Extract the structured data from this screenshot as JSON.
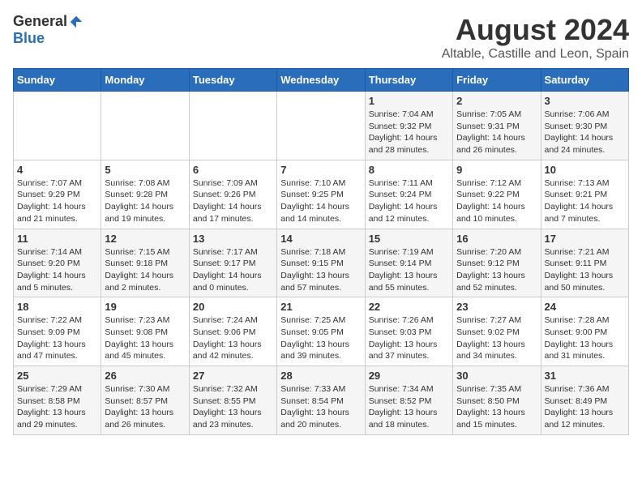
{
  "header": {
    "logo_general": "General",
    "logo_blue": "Blue",
    "main_title": "August 2024",
    "subtitle": "Altable, Castille and Leon, Spain"
  },
  "weekdays": [
    "Sunday",
    "Monday",
    "Tuesday",
    "Wednesday",
    "Thursday",
    "Friday",
    "Saturday"
  ],
  "weeks": [
    [
      {
        "day": "",
        "info": ""
      },
      {
        "day": "",
        "info": ""
      },
      {
        "day": "",
        "info": ""
      },
      {
        "day": "",
        "info": ""
      },
      {
        "day": "1",
        "info": "Sunrise: 7:04 AM\nSunset: 9:32 PM\nDaylight: 14 hours\nand 28 minutes."
      },
      {
        "day": "2",
        "info": "Sunrise: 7:05 AM\nSunset: 9:31 PM\nDaylight: 14 hours\nand 26 minutes."
      },
      {
        "day": "3",
        "info": "Sunrise: 7:06 AM\nSunset: 9:30 PM\nDaylight: 14 hours\nand 24 minutes."
      }
    ],
    [
      {
        "day": "4",
        "info": "Sunrise: 7:07 AM\nSunset: 9:29 PM\nDaylight: 14 hours\nand 21 minutes."
      },
      {
        "day": "5",
        "info": "Sunrise: 7:08 AM\nSunset: 9:28 PM\nDaylight: 14 hours\nand 19 minutes."
      },
      {
        "day": "6",
        "info": "Sunrise: 7:09 AM\nSunset: 9:26 PM\nDaylight: 14 hours\nand 17 minutes."
      },
      {
        "day": "7",
        "info": "Sunrise: 7:10 AM\nSunset: 9:25 PM\nDaylight: 14 hours\nand 14 minutes."
      },
      {
        "day": "8",
        "info": "Sunrise: 7:11 AM\nSunset: 9:24 PM\nDaylight: 14 hours\nand 12 minutes."
      },
      {
        "day": "9",
        "info": "Sunrise: 7:12 AM\nSunset: 9:22 PM\nDaylight: 14 hours\nand 10 minutes."
      },
      {
        "day": "10",
        "info": "Sunrise: 7:13 AM\nSunset: 9:21 PM\nDaylight: 14 hours\nand 7 minutes."
      }
    ],
    [
      {
        "day": "11",
        "info": "Sunrise: 7:14 AM\nSunset: 9:20 PM\nDaylight: 14 hours\nand 5 minutes."
      },
      {
        "day": "12",
        "info": "Sunrise: 7:15 AM\nSunset: 9:18 PM\nDaylight: 14 hours\nand 2 minutes."
      },
      {
        "day": "13",
        "info": "Sunrise: 7:17 AM\nSunset: 9:17 PM\nDaylight: 14 hours\nand 0 minutes."
      },
      {
        "day": "14",
        "info": "Sunrise: 7:18 AM\nSunset: 9:15 PM\nDaylight: 13 hours\nand 57 minutes."
      },
      {
        "day": "15",
        "info": "Sunrise: 7:19 AM\nSunset: 9:14 PM\nDaylight: 13 hours\nand 55 minutes."
      },
      {
        "day": "16",
        "info": "Sunrise: 7:20 AM\nSunset: 9:12 PM\nDaylight: 13 hours\nand 52 minutes."
      },
      {
        "day": "17",
        "info": "Sunrise: 7:21 AM\nSunset: 9:11 PM\nDaylight: 13 hours\nand 50 minutes."
      }
    ],
    [
      {
        "day": "18",
        "info": "Sunrise: 7:22 AM\nSunset: 9:09 PM\nDaylight: 13 hours\nand 47 minutes."
      },
      {
        "day": "19",
        "info": "Sunrise: 7:23 AM\nSunset: 9:08 PM\nDaylight: 13 hours\nand 45 minutes."
      },
      {
        "day": "20",
        "info": "Sunrise: 7:24 AM\nSunset: 9:06 PM\nDaylight: 13 hours\nand 42 minutes."
      },
      {
        "day": "21",
        "info": "Sunrise: 7:25 AM\nSunset: 9:05 PM\nDaylight: 13 hours\nand 39 minutes."
      },
      {
        "day": "22",
        "info": "Sunrise: 7:26 AM\nSunset: 9:03 PM\nDaylight: 13 hours\nand 37 minutes."
      },
      {
        "day": "23",
        "info": "Sunrise: 7:27 AM\nSunset: 9:02 PM\nDaylight: 13 hours\nand 34 minutes."
      },
      {
        "day": "24",
        "info": "Sunrise: 7:28 AM\nSunset: 9:00 PM\nDaylight: 13 hours\nand 31 minutes."
      }
    ],
    [
      {
        "day": "25",
        "info": "Sunrise: 7:29 AM\nSunset: 8:58 PM\nDaylight: 13 hours\nand 29 minutes."
      },
      {
        "day": "26",
        "info": "Sunrise: 7:30 AM\nSunset: 8:57 PM\nDaylight: 13 hours\nand 26 minutes."
      },
      {
        "day": "27",
        "info": "Sunrise: 7:32 AM\nSunset: 8:55 PM\nDaylight: 13 hours\nand 23 minutes."
      },
      {
        "day": "28",
        "info": "Sunrise: 7:33 AM\nSunset: 8:54 PM\nDaylight: 13 hours\nand 20 minutes."
      },
      {
        "day": "29",
        "info": "Sunrise: 7:34 AM\nSunset: 8:52 PM\nDaylight: 13 hours\nand 18 minutes."
      },
      {
        "day": "30",
        "info": "Sunrise: 7:35 AM\nSunset: 8:50 PM\nDaylight: 13 hours\nand 15 minutes."
      },
      {
        "day": "31",
        "info": "Sunrise: 7:36 AM\nSunset: 8:49 PM\nDaylight: 13 hours\nand 12 minutes."
      }
    ]
  ]
}
